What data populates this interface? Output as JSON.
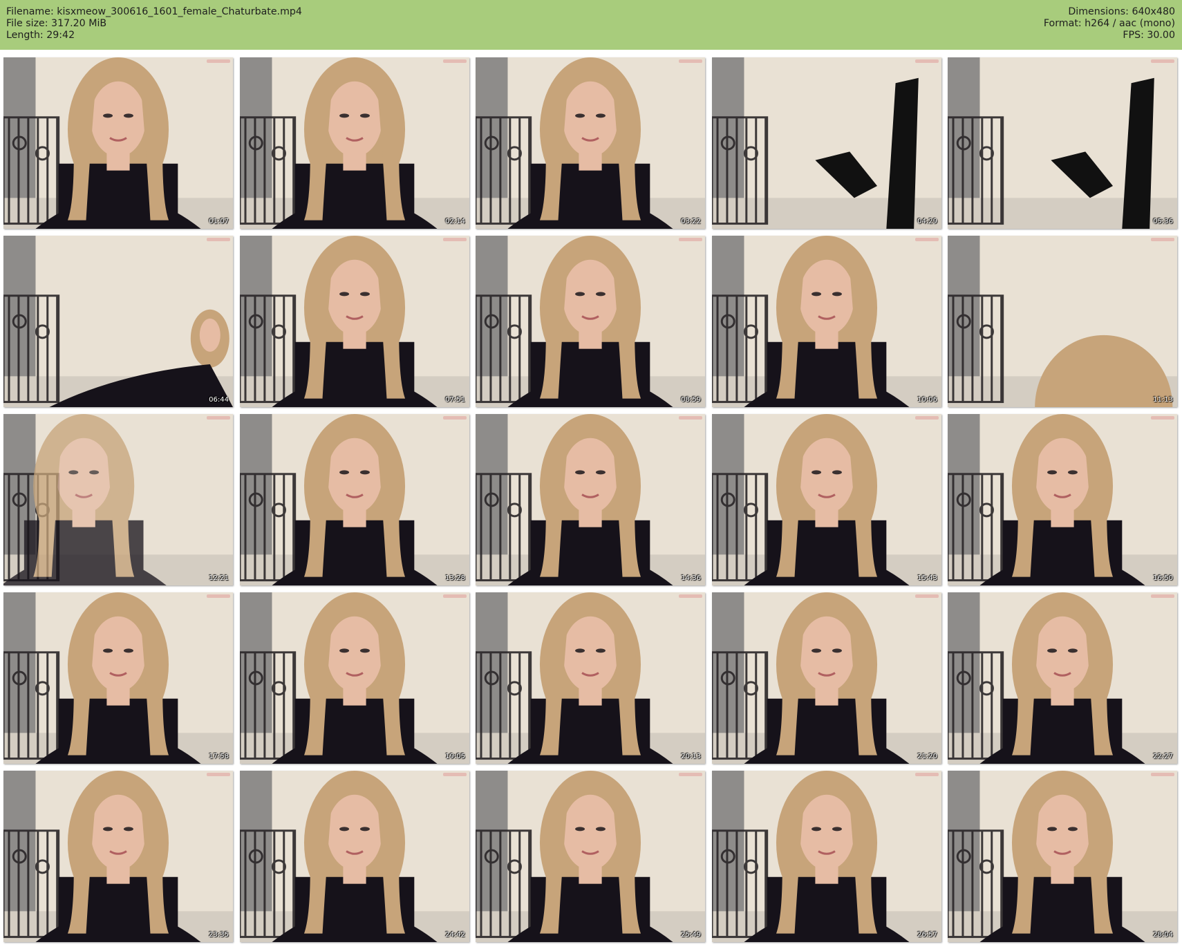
{
  "header": {
    "filename_line": "Filename: kisxmeow_300616_1601_female_Chaturbate.mp4",
    "filesize_line": "File size: 317.20 MiB",
    "length_line": "Length: 29:42",
    "dimensions_line": "Dimensions: 640x480",
    "format_line": "Format: h264 / aac (mono)",
    "fps_line": "FPS: 30.00"
  },
  "colors": {
    "header_bg": "#a8cc7c",
    "page_bg": "#ffffff",
    "wall": "#e9e1d4",
    "grey_wall": "#8e8c8a",
    "hair": "#c7a47a",
    "top": "#16121a",
    "skin": "#e6bca4"
  },
  "thumbnails": [
    {
      "time": "01:07",
      "scene": "face"
    },
    {
      "time": "02:14",
      "scene": "face"
    },
    {
      "time": "03:22",
      "scene": "face"
    },
    {
      "time": "04:29",
      "scene": "legs"
    },
    {
      "time": "05:36",
      "scene": "legs"
    },
    {
      "time": "06:44",
      "scene": "small"
    },
    {
      "time": "07:51",
      "scene": "face"
    },
    {
      "time": "08:59",
      "scene": "face"
    },
    {
      "time": "10:06",
      "scene": "face"
    },
    {
      "time": "11:13",
      "scene": "head-bottom"
    },
    {
      "time": "12:21",
      "scene": "blur"
    },
    {
      "time": "13:28",
      "scene": "face"
    },
    {
      "time": "14:36",
      "scene": "face"
    },
    {
      "time": "15:43",
      "scene": "face"
    },
    {
      "time": "16:50",
      "scene": "face"
    },
    {
      "time": "17:58",
      "scene": "face"
    },
    {
      "time": "19:05",
      "scene": "face"
    },
    {
      "time": "20:13",
      "scene": "face"
    },
    {
      "time": "21:20",
      "scene": "face"
    },
    {
      "time": "22:27",
      "scene": "face"
    },
    {
      "time": "23:35",
      "scene": "face"
    },
    {
      "time": "24:42",
      "scene": "face"
    },
    {
      "time": "25:49",
      "scene": "face"
    },
    {
      "time": "26:57",
      "scene": "face"
    },
    {
      "time": "28:04",
      "scene": "face"
    }
  ]
}
